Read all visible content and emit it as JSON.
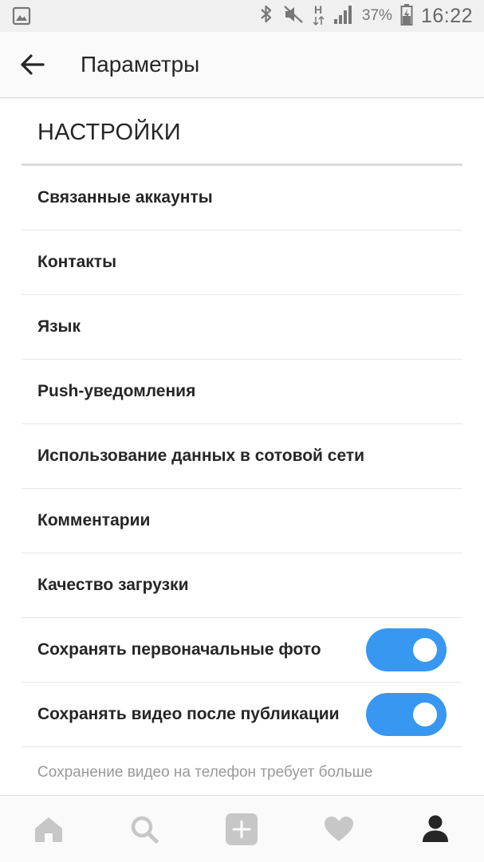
{
  "status_bar": {
    "battery_percent": "37%",
    "time": "16:22",
    "network_label": "H",
    "icons": [
      "image-icon",
      "bluetooth-icon",
      "mute-icon",
      "network-h-icon",
      "signal-icon",
      "battery-charging-icon"
    ]
  },
  "app_bar": {
    "title": "Параметры",
    "back_icon": "arrow-left-icon"
  },
  "settings": {
    "section_title": "НАСТРОЙКИ",
    "items": [
      {
        "label": "Связанные аккаунты"
      },
      {
        "label": "Контакты"
      },
      {
        "label": "Язык"
      },
      {
        "label": "Push-уведомления"
      },
      {
        "label": "Использование данных в сотовой сети"
      },
      {
        "label": "Комментарии"
      },
      {
        "label": "Качество загрузки"
      },
      {
        "label": "Сохранять первоначальные фото",
        "toggle": true,
        "on": true
      },
      {
        "label": "Сохранять видео после публикации",
        "toggle": true,
        "on": true
      }
    ],
    "note": "Сохранение видео на телефон требует больше"
  },
  "bottom_nav": {
    "items": [
      "home-icon",
      "search-icon",
      "add-icon",
      "heart-icon",
      "profile-icon"
    ],
    "active": "profile-icon"
  },
  "colors": {
    "toggle_on": "#3897f0",
    "text_primary": "#262626",
    "text_secondary": "#999999",
    "nav_inactive": "#c7c7c7",
    "nav_active": "#262626"
  }
}
